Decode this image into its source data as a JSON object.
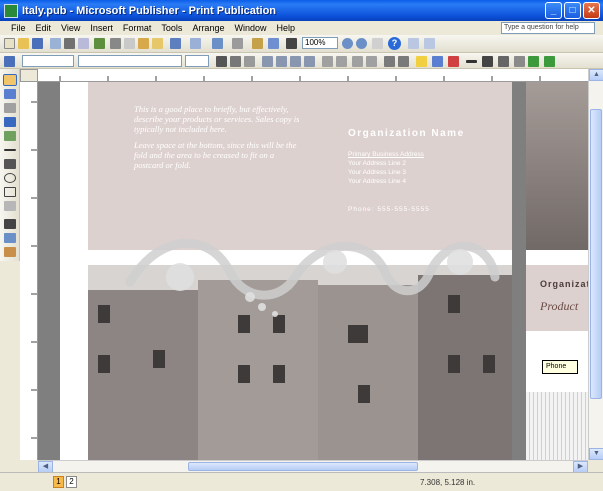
{
  "window": {
    "title": "Italy.pub - Microsoft Publisher - Print Publication"
  },
  "menu": [
    "File",
    "Edit",
    "View",
    "Insert",
    "Format",
    "Tools",
    "Arrange",
    "Window",
    "Help"
  ],
  "help_box": {
    "placeholder": "Type a question for help"
  },
  "toolbar": {
    "zoom": "100%"
  },
  "document": {
    "body_text": [
      "This is a good place to briefly, but effectively, describe your products or services. Sales copy is typically not included here.",
      "Leave space at the bottom, since this will be the fold and the area to be creased to fit on a postcard or fold."
    ],
    "organization_name": "Organization Name",
    "address_lines": [
      "Primary Business Address",
      "Your Address Line 2",
      "Your Address Line 3",
      "Your Address Line 4"
    ],
    "phone": "Phone: 555-555-5555",
    "right_org": "Organization",
    "right_product": "Product",
    "tooltip": "Phone"
  },
  "status": {
    "pages": [
      "1",
      "2"
    ],
    "coordinates": "7.308, 5.128 in."
  }
}
